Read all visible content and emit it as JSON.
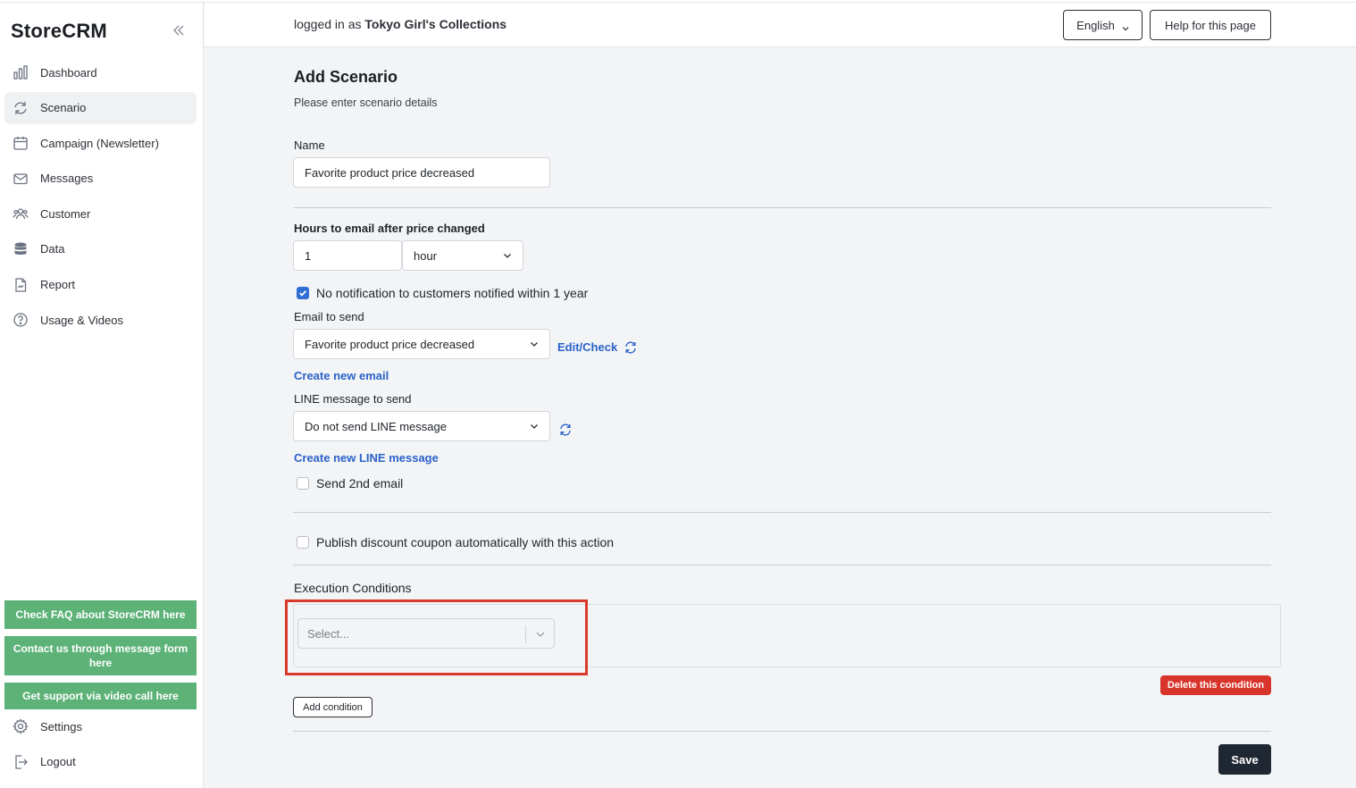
{
  "app": {
    "logo": "StoreCRM"
  },
  "sidebar": {
    "items": [
      {
        "label": "Dashboard",
        "icon": "bar-chart-icon",
        "active": false
      },
      {
        "label": "Scenario",
        "icon": "refresh-icon",
        "active": true
      },
      {
        "label": "Campaign (Newsletter)",
        "icon": "calendar-icon",
        "active": false
      },
      {
        "label": "Messages",
        "icon": "mail-icon",
        "active": false
      },
      {
        "label": "Customer",
        "icon": "users-icon",
        "active": false
      },
      {
        "label": "Data",
        "icon": "database-icon",
        "active": false
      },
      {
        "label": "Report",
        "icon": "document-icon",
        "active": false
      },
      {
        "label": "Usage & Videos",
        "icon": "help-circle-icon",
        "active": false
      }
    ],
    "support_buttons": {
      "faq": "Check FAQ about StoreCRM here",
      "contact": "Contact us through message form here",
      "video": "Get support via video call here"
    },
    "bottom_items": [
      {
        "label": "Settings",
        "icon": "gear-icon"
      },
      {
        "label": "Logout",
        "icon": "logout-icon"
      }
    ]
  },
  "header": {
    "logged_prefix": "logged in as",
    "store_name": "Tokyo Girl's Collections",
    "language": "English",
    "help": "Help for this page"
  },
  "form": {
    "title": "Add Scenario",
    "subtitle": "Please enter scenario details",
    "name_label": "Name",
    "name_value": "Favorite product price decreased",
    "hours_label": "Hours to email after price changed",
    "hours_value": "1",
    "hours_unit": "hour",
    "no_notify_label": "No notification to customers notified within 1 year",
    "no_notify_checked": true,
    "email_label": "Email to send",
    "email_value": "Favorite product price decreased",
    "edit_check": "Edit/Check",
    "create_email": "Create new email",
    "line_label": "LINE message to send",
    "line_value": "Do not send LINE message",
    "create_line": "Create new LINE message",
    "second_email_label": "Send 2nd email",
    "coupon_label": "Publish discount coupon automatically with this action",
    "exec_label": "Execution Conditions",
    "select_placeholder": "Select...",
    "delete_condition": "Delete this condition",
    "add_condition": "Add condition",
    "save": "Save"
  },
  "colors": {
    "accent": "#2a62c9",
    "support_green": "#5db277",
    "danger": "#d9342b",
    "highlight": "#d93a2b",
    "save_dark": "#1f2733"
  }
}
